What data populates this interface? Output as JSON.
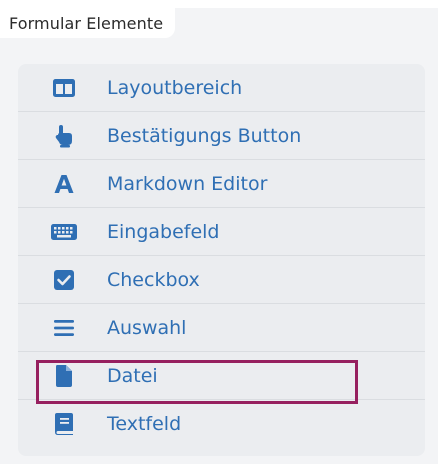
{
  "section": {
    "title": "Formular Elemente"
  },
  "items": [
    {
      "label": "Layoutbereich",
      "icon": "layout-columns-icon"
    },
    {
      "label": "Bestätigungs Button",
      "icon": "pointer-hand-icon"
    },
    {
      "label": "Markdown Editor",
      "icon": "font-letter-a-icon"
    },
    {
      "label": "Eingabefeld",
      "icon": "keyboard-icon"
    },
    {
      "label": "Checkbox",
      "icon": "checkbox-checked-icon"
    },
    {
      "label": "Auswahl",
      "icon": "list-lines-icon"
    },
    {
      "label": "Datei",
      "icon": "file-icon"
    },
    {
      "label": "Textfeld",
      "icon": "book-icon"
    }
  ],
  "highlighted_item": "Datei",
  "colors": {
    "accent": "#2f6fb4",
    "highlight_border": "#96205f",
    "panel_bg": "#ebedf0"
  }
}
